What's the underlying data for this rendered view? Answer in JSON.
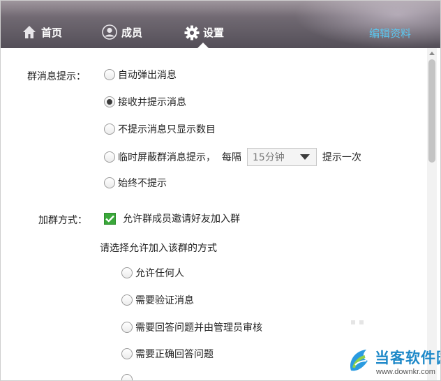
{
  "header": {
    "tabs": [
      {
        "label": "首页",
        "icon": "home-icon"
      },
      {
        "label": "成员",
        "icon": "member-icon"
      },
      {
        "label": "设置",
        "icon": "gear-icon"
      }
    ],
    "edit_link": "编辑资料",
    "colors": {
      "header_bg": "#6e6770",
      "edit_link": "#5bc6ef"
    }
  },
  "group_notify": {
    "label": "群消息提示：",
    "options": [
      {
        "label": "自动弹出消息",
        "checked": false
      },
      {
        "label": "接收并提示消息",
        "checked": true
      },
      {
        "label": "不提示消息只显示数目",
        "checked": false
      },
      {
        "label": "临时屏蔽群消息提示，  每隔",
        "checked": false
      },
      {
        "label": "始终不提示",
        "checked": false
      }
    ],
    "interval_select": {
      "value": "15分钟",
      "suffix": "提示一次"
    }
  },
  "join_method": {
    "label": "加群方式：",
    "allow_invite": {
      "label": "允许群成员邀请好友加入群",
      "checked": true
    },
    "choose_prompt": "请选择允许加入该群的方式",
    "options": [
      {
        "label": "允许任何人",
        "checked": false
      },
      {
        "label": "需要验证消息",
        "checked": false
      },
      {
        "label": "需要回答问题并由管理员审核",
        "checked": false
      },
      {
        "label": "需要正确回答问题",
        "checked": false
      }
    ]
  },
  "watermark": {
    "name": "当客软件园",
    "url": "www.downkr.com",
    "color": "#1d88c8"
  }
}
